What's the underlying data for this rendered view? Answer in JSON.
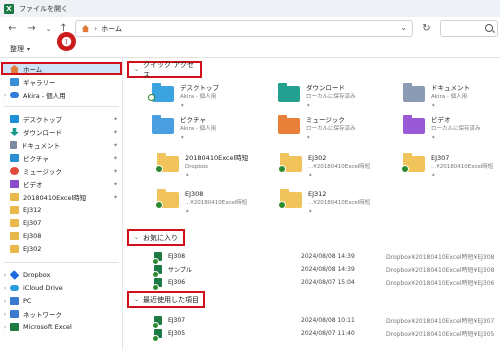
{
  "window": {
    "title": "ファイルを開く"
  },
  "nav": {
    "back_icon": "back-arrow-icon",
    "forward_icon": "forward-arrow-icon",
    "dropdown_icon": "chevron-down-icon",
    "up_icon": "up-arrow-icon",
    "location": "ホーム",
    "refresh_icon": "refresh-icon",
    "search_placeholder": ""
  },
  "toolbar": {
    "organize_label": "整理"
  },
  "annotation": {
    "badge": "❶"
  },
  "sidebar": {
    "items": [
      {
        "label": "ホーム",
        "icon": "home-icon",
        "color": "#e07a3a"
      },
      {
        "label": "ギャラリー",
        "icon": "gallery-icon",
        "color": "#3a8fd6"
      },
      {
        "label": "Akira - 個人用",
        "icon": "onedrive-icon",
        "color": "#2e7dd8"
      },
      {
        "label": "デスクトップ",
        "icon": "desktop-icon",
        "color": "#1e90d8"
      },
      {
        "label": "ダウンロード",
        "icon": "download-icon",
        "color": "#1a9a8a"
      },
      {
        "label": "ドキュメント",
        "icon": "documents-icon",
        "color": "#7a8ba3"
      },
      {
        "label": "ピクチャ",
        "icon": "pictures-icon",
        "color": "#2a8fd0"
      },
      {
        "label": "ミュージック",
        "icon": "music-icon",
        "color": "#e04a3a"
      },
      {
        "label": "ビデオ",
        "icon": "videos-icon",
        "color": "#8a4ad0"
      },
      {
        "label": "20180410Excel時短",
        "icon": "folder-icon",
        "color": "#e8b84a"
      },
      {
        "label": "EJ312",
        "icon": "folder-icon",
        "color": "#e8b84a"
      },
      {
        "label": "EJ307",
        "icon": "folder-icon",
        "color": "#e8b84a"
      },
      {
        "label": "EJ308",
        "icon": "folder-icon",
        "color": "#e8b84a"
      },
      {
        "label": "EJ302",
        "icon": "folder-icon",
        "color": "#e8b84a"
      },
      {
        "label": "Dropbox",
        "icon": "dropbox-icon",
        "color": "#1a6ae0"
      },
      {
        "label": "iCloud Drive",
        "icon": "icloud-icon",
        "color": "#2a9ae0"
      },
      {
        "label": "PC",
        "icon": "pc-icon",
        "color": "#3a7ad0"
      },
      {
        "label": "ネットワーク",
        "icon": "network-icon",
        "color": "#3a7ad0"
      },
      {
        "label": "Microsoft Excel",
        "icon": "excel-icon",
        "color": "#1d7a44"
      }
    ]
  },
  "main": {
    "quick_access": {
      "header": "クイック アクセス",
      "items": [
        {
          "name": "デスクトップ",
          "sub": "Akira - 個人用",
          "icon": "desktop-folder-icon",
          "color": "#3aa3e0"
        },
        {
          "name": "ダウンロード",
          "sub": "ローカルに保存済み",
          "icon": "download-folder-icon",
          "color": "#22a090"
        },
        {
          "name": "ドキュメント",
          "sub": "Akira - 個人用",
          "icon": "documents-folder-icon",
          "color": "#8a9bb3"
        },
        {
          "name": "ピクチャ",
          "sub": "Akira - 個人用",
          "icon": "pictures-folder-icon",
          "color": "#4a9fe0"
        },
        {
          "name": "ミュージック",
          "sub": "ローカルに保存済み",
          "icon": "music-folder-icon",
          "color": "#e8803a"
        },
        {
          "name": "ビデオ",
          "sub": "ローカルに保存済み",
          "icon": "videos-folder-icon",
          "color": "#9a5ad8"
        },
        {
          "name": "20180410Excel時短",
          "sub": "Dropbox",
          "icon": "folder-icon",
          "color": "#f0c45a"
        },
        {
          "name": "EJ302",
          "sub": "...¥20180410Excel時短",
          "icon": "folder-icon",
          "color": "#f0c45a"
        },
        {
          "name": "EJ307",
          "sub": "...¥20180410Excel時短",
          "icon": "folder-icon",
          "color": "#f0c45a"
        },
        {
          "name": "EJ308",
          "sub": "...¥20180410Excel時短",
          "icon": "folder-icon",
          "color": "#f0c45a"
        },
        {
          "name": "EJ312",
          "sub": "...¥20180410Excel時短",
          "icon": "folder-icon",
          "color": "#f0c45a"
        }
      ]
    },
    "favorites": {
      "header": "お気に入り",
      "rows": [
        {
          "name": "EJ308",
          "date": "2024/08/08 14:39",
          "path": "Dropbox¥20180410Excel時短¥EJ308"
        },
        {
          "name": "サンプル",
          "date": "2024/08/08 14:39",
          "path": "Dropbox¥20180410Excel時短¥EJ308"
        },
        {
          "name": "EJ306",
          "date": "2024/08/07 15:04",
          "path": "Dropbox¥20180410Excel時短¥EJ306"
        }
      ]
    },
    "recent": {
      "header": "最近使用した項目",
      "rows": [
        {
          "name": "EJ307",
          "date": "2024/08/08 10:11",
          "path": "Dropbox¥20180410Excel時短¥EJ307"
        },
        {
          "name": "EJ305",
          "date": "2024/08/07 11:40",
          "path": "Dropbox¥20180410Excel時短¥EJ305"
        }
      ]
    }
  },
  "colors": {
    "annotation_red": "#d0101a",
    "selection_blue": "#cfe3f8",
    "excel_green": "#1d7a44"
  }
}
